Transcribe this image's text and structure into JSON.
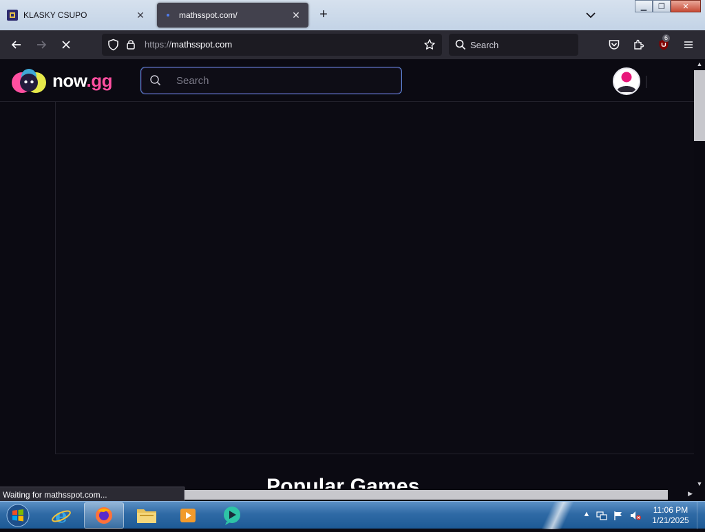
{
  "browser": {
    "tabs": [
      {
        "title": "KLASKY CSUPO",
        "active": false
      },
      {
        "title": "mathsspot.com/",
        "active": true
      }
    ],
    "url_scheme": "https://",
    "url_host": "mathsspot.com",
    "search_placeholder": "Search",
    "extension_badge": "6",
    "status_text": "Waiting for mathsspot.com..."
  },
  "site": {
    "logo_text": "now",
    "logo_accent": ".gg",
    "search_placeholder": "Search",
    "section_title": "Popular Games"
  },
  "taskbar": {
    "time": "11:06 PM",
    "date": "1/21/2025"
  },
  "colors": {
    "page_bg": "#0b0a12",
    "toolbar_bg": "#2b2a33",
    "url_bg": "#1c1b22",
    "accent_pink": "#ff4fa0",
    "search_border": "#5d8ddb",
    "taskbar_blue": "#2f6aa5"
  }
}
